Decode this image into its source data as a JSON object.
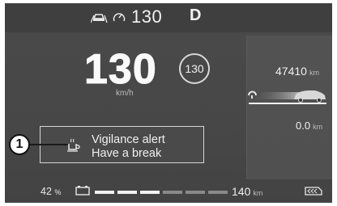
{
  "top": {
    "icons": [
      "cruise-car-icon",
      "speed-limiter-icon"
    ],
    "set_speed": "130",
    "gear": "D"
  },
  "speed": {
    "value": "130",
    "unit": "km/h",
    "limit_sign": "130"
  },
  "alert": {
    "icon": "coffee-cup-icon",
    "line1": "Vigilance alert",
    "line2": "Have a break",
    "callout": "1"
  },
  "right_panel": {
    "odometer": "47410",
    "odometer_unit": "km",
    "trip": "0.0",
    "trip_unit": "km"
  },
  "bottom": {
    "level_percent": "42",
    "level_unit": "%",
    "gauge_segments_total": 6,
    "gauge_segments_on": 3,
    "range": "140",
    "range_unit": "km"
  }
}
